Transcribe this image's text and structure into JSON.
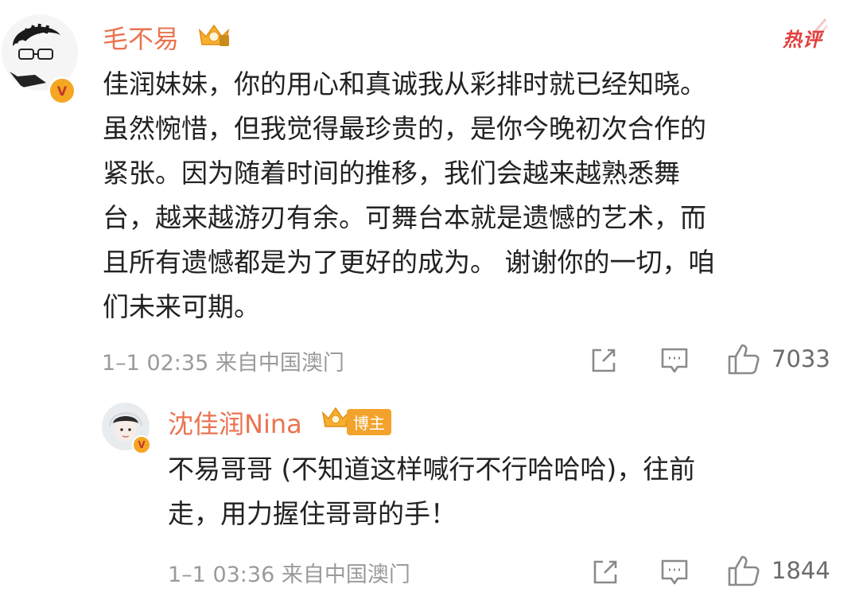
{
  "main_comment": {
    "username": "毛不易",
    "hot_label": "热评",
    "text_lines": [
      "佳润妹妹，你的用心和真诚我从彩排时就已经知晓。",
      "虽然惋惜，但我觉得最珍贵的，是你今晚初次合作的",
      "紧张。因为随着时间的推移，我们会越来越熟悉舞",
      "台，越来越游刃有余。可舞台本就是遗憾的艺术，而",
      "且所有遗憾都是为了更好的成为。 谢谢你的一切，咱",
      "们未来可期。"
    ],
    "meta": "1–1 02:35  来自中国澳门",
    "like_count": "7033",
    "icons": [
      "share-icon",
      "comment-icon",
      "like-icon"
    ]
  },
  "reply": {
    "username": "沈佳润Nina",
    "tag": "博主",
    "text_lines": [
      "不易哥哥 (不知道这样喊行不行哈哈哈)，往前",
      "走，用力握住哥哥的手！"
    ],
    "meta": "1–1 03:36  来自中国澳门",
    "like_count": "1844",
    "icons": [
      "share-icon",
      "comment-icon",
      "like-icon"
    ]
  },
  "colors": {
    "username": "#eb7350",
    "hot_badge": "#e33e3e",
    "body_text": "#222222",
    "meta_text": "#9a9a9a",
    "verified_badge": "#f5a623"
  }
}
